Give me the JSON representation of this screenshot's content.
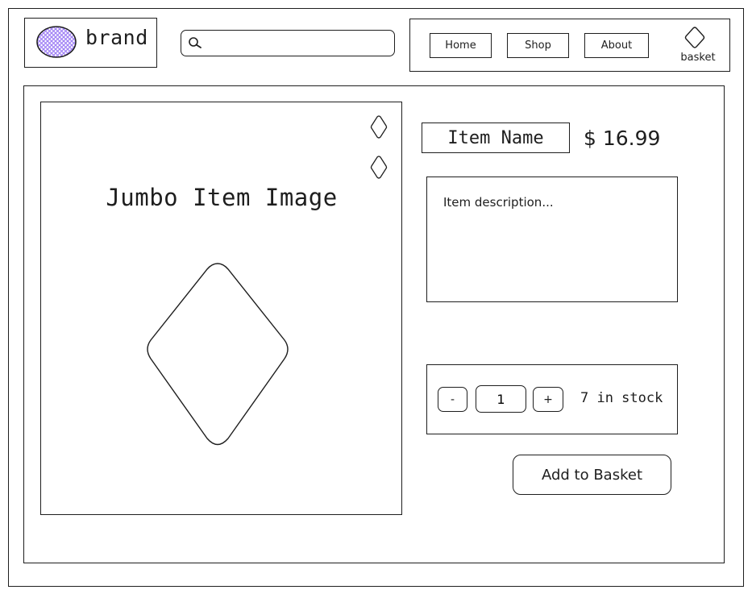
{
  "header": {
    "brand": {
      "name": "brand",
      "logo_icon": "hatched-circle-logo",
      "logo_color": "#a182f5"
    },
    "search": {
      "icon": "search-icon",
      "placeholder": ""
    },
    "nav": {
      "items": [
        {
          "label": "Home"
        },
        {
          "label": "Shop"
        },
        {
          "label": "About"
        }
      ],
      "basket": {
        "icon": "diamond-icon",
        "label": "basket"
      }
    }
  },
  "product": {
    "image": {
      "title": "Jumbo Item Image",
      "thumbnails": [
        {
          "icon": "diamond-icon"
        },
        {
          "icon": "diamond-icon"
        }
      ],
      "placeholder_icon": "diamond-icon"
    },
    "name": "Item Name",
    "price": "$ 16.99",
    "description": "Item description...",
    "quantity": {
      "decrement_label": "-",
      "value": "1",
      "increment_label": "+",
      "stock_text": "7 in stock"
    },
    "add_to_basket_label": "Add to Basket"
  },
  "colors": {
    "stroke": "#1e1e1e",
    "logo_fill": "#a182f5",
    "background": "#ffffff"
  }
}
